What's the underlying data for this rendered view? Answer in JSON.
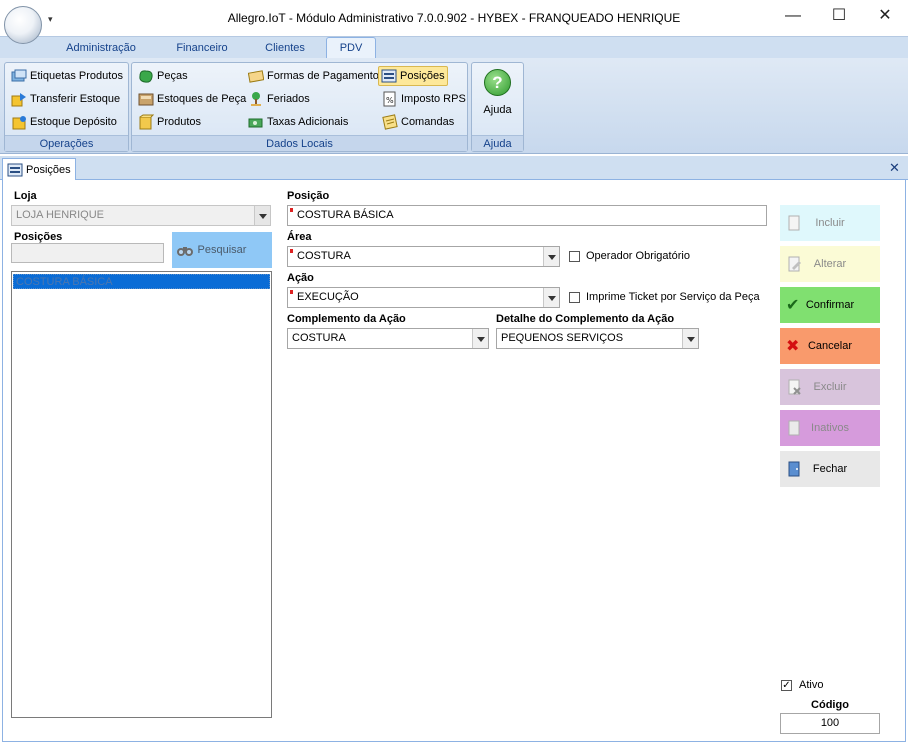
{
  "window": {
    "title": "Allegro.IoT - Módulo Administrativo 7.0.0.902 - HYBEX - FRANQUEADO HENRIQUE",
    "qat_symbol": "▾",
    "minimize_symbol": "—",
    "maximize_symbol": "☐",
    "close_symbol": "✕"
  },
  "ribbon_tabs": [
    "Administração",
    "Financeiro",
    "Clientes",
    "PDV"
  ],
  "ribbon": {
    "operacoes": {
      "label": "Operações",
      "items": [
        "Etiquetas Produtos",
        "Transferir Estoque",
        "Estoque Depósito"
      ]
    },
    "dados_locais": {
      "label": "Dados Locais",
      "col1": [
        "Peças",
        "Estoques de Peça",
        "Produtos"
      ],
      "col2": [
        "Formas de Pagamento",
        "Feriados",
        "Taxas Adicionais"
      ],
      "col3": [
        "Posições",
        "Imposto RPS",
        "Comandas"
      ]
    },
    "ajuda": {
      "label": "Ajuda",
      "button": "Ajuda",
      "icon_glyph": "?"
    }
  },
  "doc_tab": {
    "label": "Posições",
    "close_symbol": "✕"
  },
  "form": {
    "loja_label": "Loja",
    "loja_value": "LOJA HENRIQUE",
    "posicoes_label": "Posições",
    "posicoes_search_value": "",
    "pesquisar_label": "Pesquisar",
    "posicoes_list": [
      "COSTURA BÁSICA"
    ],
    "posicao_label": "Posição",
    "posicao_value": "COSTURA BÁSICA",
    "area_label": "Área",
    "area_value": "COSTURA",
    "operador_obrigatorio_label": "Operador Obrigatório",
    "acao_label": "Ação",
    "acao_value": "EXECUÇÃO",
    "imprime_ticket_label": "Imprime Ticket por Serviço da Peça",
    "complemento_label": "Complemento da Ação",
    "complemento_value": "COSTURA",
    "detalhe_label": "Detalhe do Complemento da Ação",
    "detalhe_value": "PEQUENOS SERVIÇOS",
    "ativo_label": "Ativo",
    "ativo_check": "✓",
    "codigo_label": "Código",
    "codigo_value": "100"
  },
  "actions": {
    "incluir": "Incluir",
    "alterar": "Alterar",
    "confirmar": "Confirmar",
    "confirmar_icon": "✔",
    "cancelar": "Cancelar",
    "cancelar_icon": "✖",
    "excluir": "Excluir",
    "inativos": "Inativos",
    "fechar": "Fechar"
  },
  "colors": {
    "incluir_bg": "#dff8fc",
    "alterar_bg": "#fbfbd6",
    "confirmar_bg": "#80e070",
    "cancelar_bg": "#f99a6c",
    "excluir_bg": "#d8c4dc",
    "inativos_bg": "#d69bdc",
    "fechar_bg": "#e8e8e8",
    "pesquisar_bg": "#8fc8f6",
    "list_selected_bg": "#0a6cd6"
  }
}
